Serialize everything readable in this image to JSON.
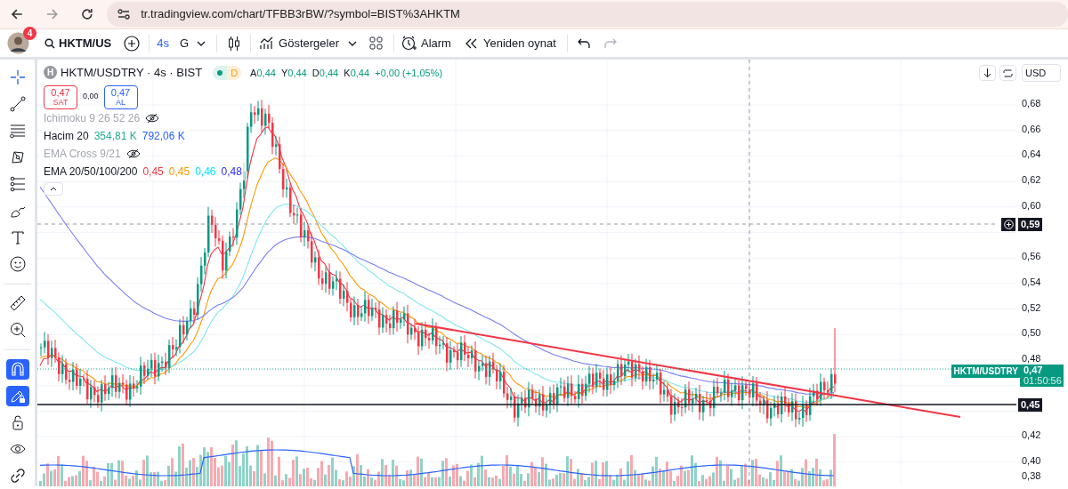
{
  "browser": {
    "url": "tr.tradingview.com/chart/TFBB3rBW/?symbol=BIST%3AHKTM"
  },
  "toolbar": {
    "avatar_badge": "4",
    "symbol": "HKTM/US",
    "intervals": [
      {
        "label": "4s",
        "selected": true
      },
      {
        "label": "G",
        "selected": false
      }
    ],
    "indicators_label": "Göstergeler",
    "alarm_label": "Alarm",
    "replay_label": "Yeniden oynat",
    "redo_disabled": true
  },
  "drawing_tools": [
    {
      "kind": "crosshair",
      "selected": true
    },
    {
      "kind": "trendline",
      "selected": false
    },
    {
      "kind": "fib",
      "selected": false
    },
    {
      "kind": "pattern",
      "selected": false
    },
    {
      "kind": "projection",
      "selected": false
    },
    {
      "kind": "brush",
      "selected": false
    },
    {
      "kind": "text",
      "selected": false
    },
    {
      "kind": "emoji",
      "selected": false
    }
  ],
  "measure_tools": [
    {
      "kind": "ruler"
    },
    {
      "kind": "zoom"
    }
  ],
  "toggle_tools": [
    {
      "kind": "magnet",
      "on": true
    },
    {
      "kind": "drawing-lock",
      "on": true
    },
    {
      "kind": "lock",
      "on": false
    },
    {
      "kind": "eye",
      "on": false
    },
    {
      "kind": "link",
      "on": false
    }
  ],
  "legend": {
    "logo_letter": "H",
    "title": "HKTM/USDTRY · 4s · BIST",
    "market_status": "D",
    "ohlc": [
      {
        "label": "A",
        "value": "0,44"
      },
      {
        "label": "Y",
        "value": "0,44"
      },
      {
        "label": "D",
        "value": "0,44"
      },
      {
        "label": "K",
        "value": "0,44"
      }
    ],
    "change": "+0,00 (+1,05%)",
    "sell": {
      "price": "0,47",
      "label": "SAT"
    },
    "spread": "0,00",
    "buy": {
      "price": "0,47",
      "label": "AL"
    }
  },
  "indicators": [
    {
      "name": "Ichimoku 9 26 52 26",
      "hidden": true
    },
    {
      "name": "Hacim 20",
      "hidden": false,
      "values": [
        {
          "text": "354,81 K",
          "color": "#22ab94"
        },
        {
          "text": "792,06 K",
          "color": "#2962ff"
        }
      ]
    },
    {
      "name": "EMA Cross 9/21",
      "hidden": true
    },
    {
      "name": "EMA 20/50/100/200",
      "hidden": false,
      "values": [
        {
          "text": "0,45",
          "color": "#f23645"
        },
        {
          "text": "0,45",
          "color": "#ff9800"
        },
        {
          "text": "0,46",
          "color": "#00e5ff"
        },
        {
          "text": "0,48",
          "color": "#2e2eff"
        }
      ]
    }
  ],
  "price_axis": {
    "currency": "USD",
    "ticks": [
      {
        "label": "0,68"
      },
      {
        "label": "0,66"
      },
      {
        "label": "0,64"
      },
      {
        "label": "0,62"
      },
      {
        "label": "0,60"
      },
      {
        "label": "0,56"
      },
      {
        "label": "0,54"
      },
      {
        "label": "0,52"
      },
      {
        "label": "0,50"
      },
      {
        "label": "0,48"
      },
      {
        "label": "0,42"
      },
      {
        "label": "0,40"
      },
      {
        "label": "0,38"
      }
    ],
    "crosshair_price": "0,59",
    "last_price": {
      "symbol": "HKTM/USDTRY",
      "price": "0,47",
      "countdown": "01:50:56"
    },
    "line_price": "0,45"
  }
}
